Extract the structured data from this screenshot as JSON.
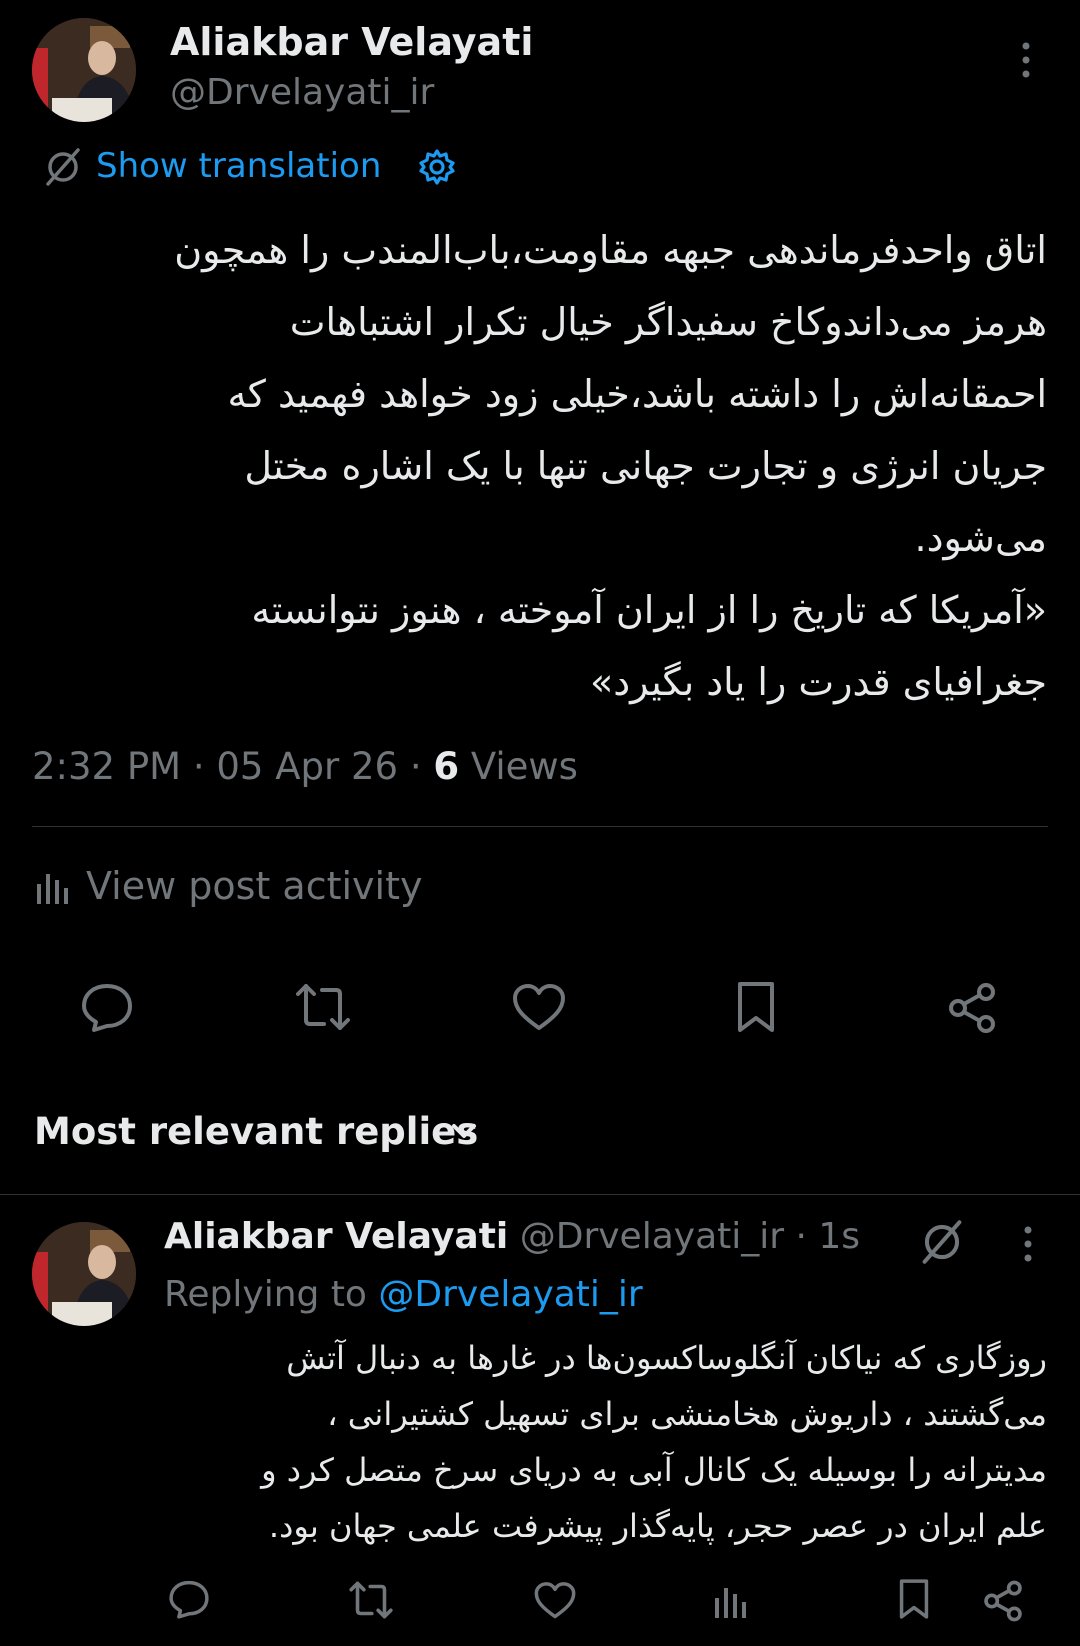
{
  "post": {
    "author_name": "Aliakbar Velayati",
    "author_handle": "@Drvelayati_ir",
    "translate_label": "Show translation",
    "lines": [
      "اتاق واحدفرماندهی جبهه مقاومت،باب‌المندب را همچون",
      "هرمز می‌داندوکاخ سفیداگر خیال تکرار اشتباهات",
      "احمقانه‌اش را داشته باشد،خیلی زود خواهد فهمید که",
      "جریان انرژی و تجارت جهانی تنها با یک اشاره مختل",
      "می‌شود.",
      "«آمریکا که تاریخ را از ایران آموخته ، هنوز نتوانسته",
      "جغرافیای قدرت را یاد بگیرد»"
    ],
    "time": "2:32 PM · 05 Apr 26 · ",
    "views_count": "6",
    "views_label": " Views",
    "activity_label": "View post activity"
  },
  "replies_header": {
    "label": "Most relevant replies"
  },
  "reply": {
    "author_name": "Aliakbar Velayati",
    "handle_time": "@Drvelayati_ir · 1s",
    "replying_prefix": "Replying to ",
    "replying_handle": "@Drvelayati_ir",
    "lines": [
      "روزگاری که نیاکان آنگلوساکسون‌ها در غارها به دنبال آتش",
      "می‌گشتند ، داریوش هخامنشی برای تسهیل کشتیرانی ،",
      "مدیترانه را بوسیله یک کانال آبی به دریای سرخ متصل کرد و",
      "علم ایران در عصر حجر، پایه‌گذار پیشرفت علمی جهان  بود."
    ]
  },
  "colors": {
    "background": "#000000",
    "text": "#e7e9ea",
    "secondary": "#71767b",
    "accent": "#1d9bf0"
  },
  "icons": [
    "more-icon",
    "translate-icon",
    "settings-icon",
    "analytics-icon",
    "reply-icon",
    "repost-icon",
    "like-icon",
    "bookmark-icon",
    "share-icon",
    "chevron-down-icon"
  ]
}
